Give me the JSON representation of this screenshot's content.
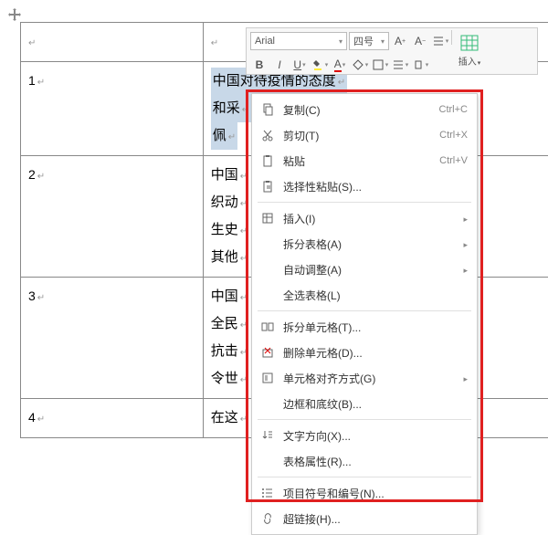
{
  "toolbar": {
    "font": "Arial",
    "size": "四号",
    "insert_label": "插入"
  },
  "table": {
    "rows": [
      {
        "n": "1",
        "lines": [
          "中国对待疫情的态度",
          "和采",
          "佩"
        ]
      },
      {
        "n": "2",
        "lines": [
          "中国",
          "织动",
          "生史",
          "其他"
        ]
      },
      {
        "n": "3",
        "lines": [
          "中国",
          "全民",
          "抗击",
          "令世"
        ]
      },
      {
        "n": "4",
        "lines": [
          "在这"
        ]
      }
    ]
  },
  "menu": {
    "copy": "复制(C)",
    "copy_sc": "Ctrl+C",
    "cut": "剪切(T)",
    "cut_sc": "Ctrl+X",
    "paste": "粘贴",
    "paste_sc": "Ctrl+V",
    "paste_special": "选择性粘贴(S)...",
    "insert": "插入(I)",
    "split_table": "拆分表格(A)",
    "autofit": "自动调整(A)",
    "select_table": "全选表格(L)",
    "split_cells": "拆分单元格(T)...",
    "delete_cells": "删除单元格(D)...",
    "cell_align": "单元格对齐方式(G)",
    "borders": "边框和底纹(B)...",
    "text_dir": "文字方向(X)...",
    "table_props": "表格属性(R)...",
    "bullets": "项目符号和编号(N)...",
    "hyperlink": "超链接(H)..."
  }
}
